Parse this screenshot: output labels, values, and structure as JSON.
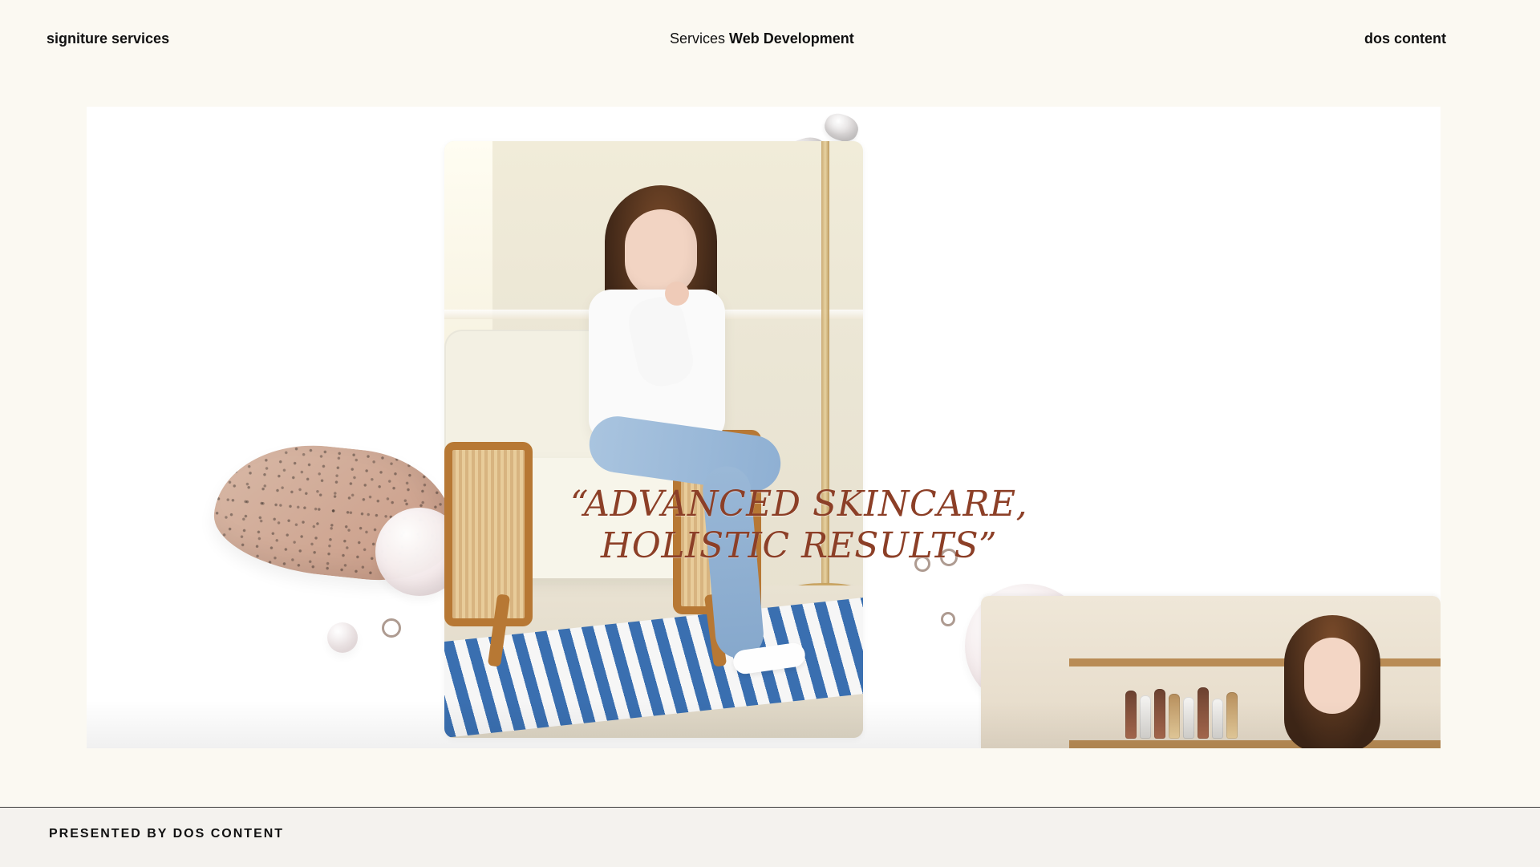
{
  "header": {
    "left_label": "signiture services",
    "center_prefix": "Services",
    "center_highlight": "Web Development",
    "right_label": "dos content"
  },
  "hero": {
    "quote": "“ADVANCED SKINCARE, HOLISTIC RESULTS”"
  },
  "footer": {
    "presented": "PRESENTED BY DOS CONTENT"
  },
  "colors": {
    "page_bg": "#fbf9f2",
    "panel_bg": "#ffffff",
    "quote": "#8c3f27",
    "footer_bg": "#f4f2ee",
    "divider": "#3a3a3a"
  },
  "icons": {
    "bubble": "bubble-decoration",
    "droplet": "water-droplet",
    "ring": "ring-decoration",
    "clay": "clay-smear"
  }
}
